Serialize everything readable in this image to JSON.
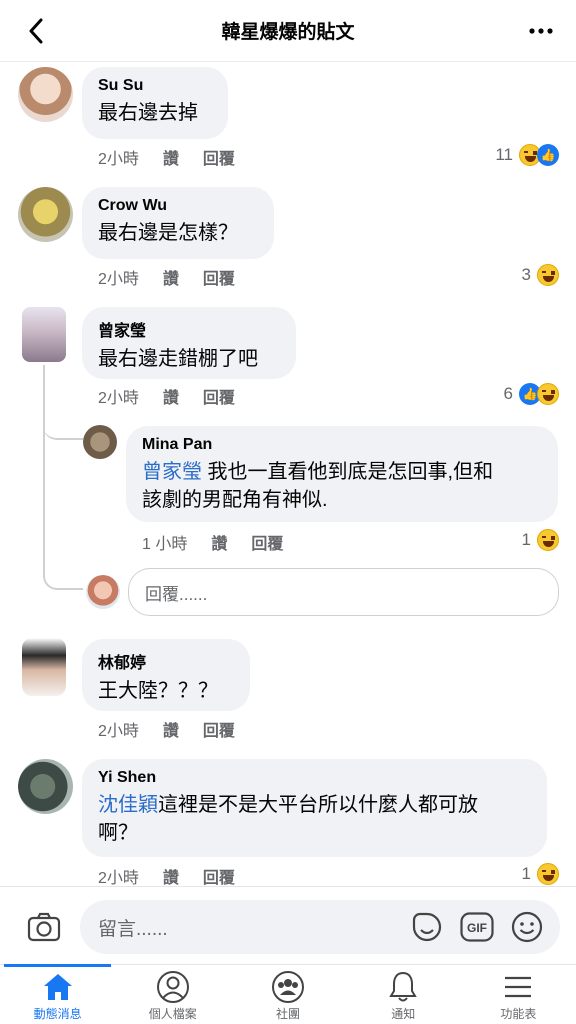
{
  "header": {
    "title": "韓星爆爆的貼文"
  },
  "comments": [
    {
      "name": "Su Su",
      "text": "最右邊去掉",
      "time": "2小時",
      "read": "讚",
      "reply": "回覆",
      "count": "11"
    },
    {
      "name": "Crow Wu",
      "text": "最右邊是怎樣？",
      "time": "2小時",
      "read": "讚",
      "reply": "回覆",
      "count": "3"
    },
    {
      "name": "曾家瑩",
      "text": "最右邊走錯棚了吧",
      "time": "2小時",
      "read": "讚",
      "reply": "回覆",
      "count": "6"
    },
    {
      "name": "林郁婷",
      "text": "王大陸？？？",
      "time": "2小時",
      "read": "讚",
      "reply": "回覆"
    },
    {
      "name": "Yi Shen",
      "mention": "沈佳穎",
      "text": "這裡是不是大平台所以什麼人都可放",
      "text2": "啊？",
      "time": "2小時",
      "read": "讚",
      "reply": "回覆",
      "count": "1"
    }
  ],
  "reply": {
    "name": "Mina Pan",
    "mention": "曾家瑩",
    "text": " 我也一直看他到底是怎回事,但和",
    "text2": "該劇的男配角有神似.",
    "time": "1 小時",
    "read": "讚",
    "reply": "回覆",
    "count": "1"
  },
  "reply_input": {
    "placeholder": "回覆......"
  },
  "comment_input": {
    "placeholder": "留言......",
    "gif": "GIF"
  },
  "tabs": [
    {
      "label": "動態消息",
      "icon": "home-icon"
    },
    {
      "label": "個人檔案",
      "icon": "profile-icon"
    },
    {
      "label": "社團",
      "icon": "groups-icon"
    },
    {
      "label": "通知",
      "icon": "bell-icon"
    },
    {
      "label": "功能表",
      "icon": "menu-icon"
    }
  ],
  "colors": {
    "accent": "#1877f2",
    "mention": "#2b6dc9",
    "bubble": "#f0f2f5"
  }
}
